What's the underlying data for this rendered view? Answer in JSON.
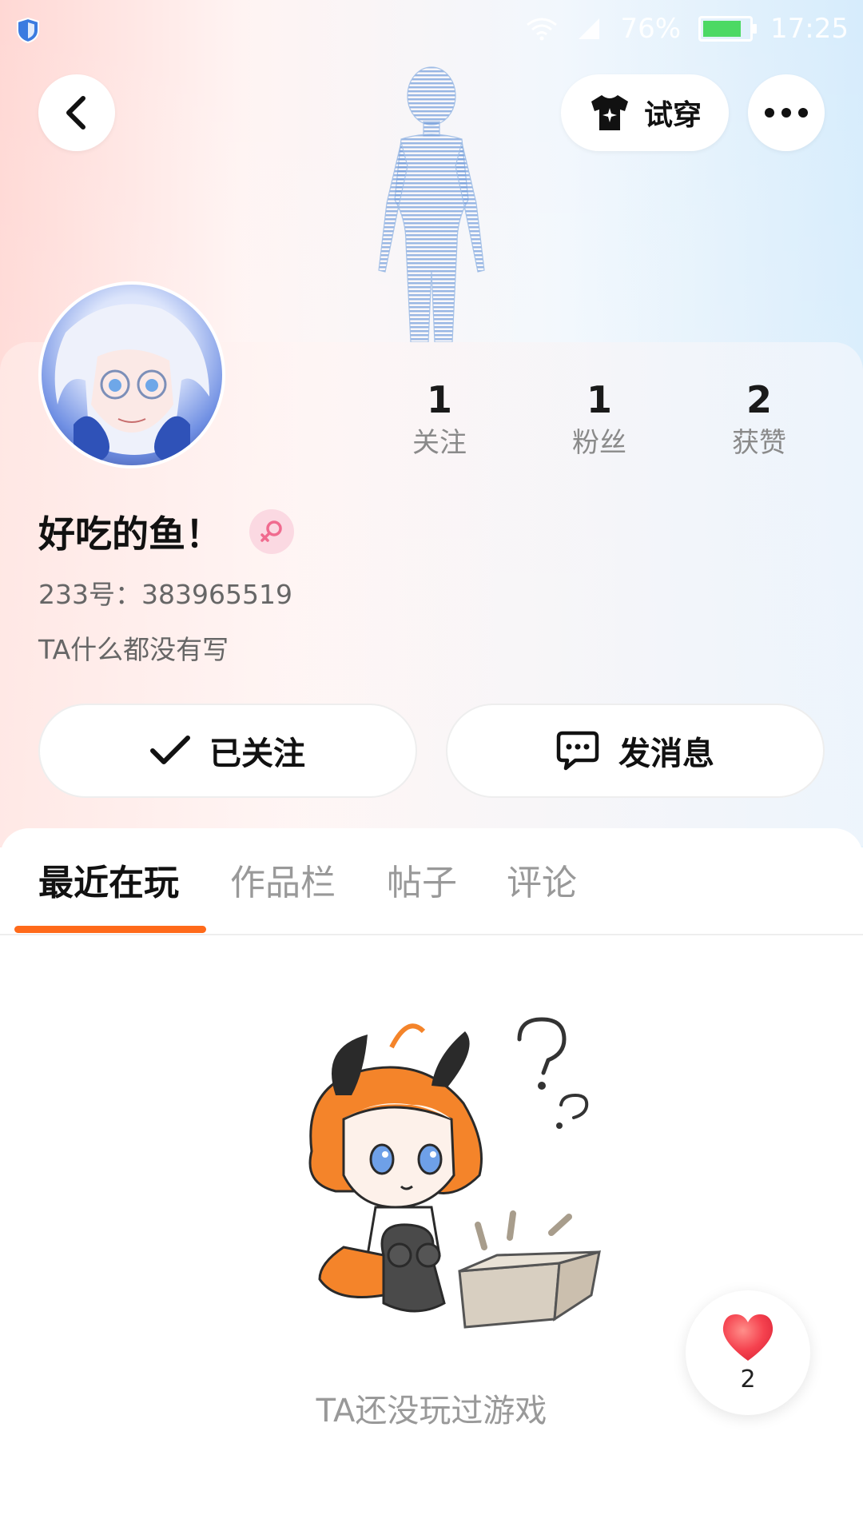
{
  "status_bar": {
    "battery": "76%",
    "time": "17:25"
  },
  "header": {
    "try_on_label": "试穿"
  },
  "profile": {
    "name": "好吃的鱼！",
    "uid": "233号：383965519",
    "bio": "TA什么都没有写",
    "gender": "female"
  },
  "stats": [
    {
      "value": "1",
      "label": "关注"
    },
    {
      "value": "1",
      "label": "粉丝"
    },
    {
      "value": "2",
      "label": "获赞"
    }
  ],
  "actions": {
    "follow_label": "已关注",
    "message_label": "发消息"
  },
  "tabs": [
    {
      "label": "最近在玩",
      "active": true
    },
    {
      "label": "作品栏",
      "active": false
    },
    {
      "label": "帖子",
      "active": false
    },
    {
      "label": "评论",
      "active": false
    }
  ],
  "empty_state": {
    "text": "TA还没玩过游戏"
  },
  "like_fab": {
    "count": "2"
  },
  "colors": {
    "accent": "#ff6a1a",
    "gender_badge_bg": "#fbd9e2",
    "heart": "#f5424f"
  }
}
